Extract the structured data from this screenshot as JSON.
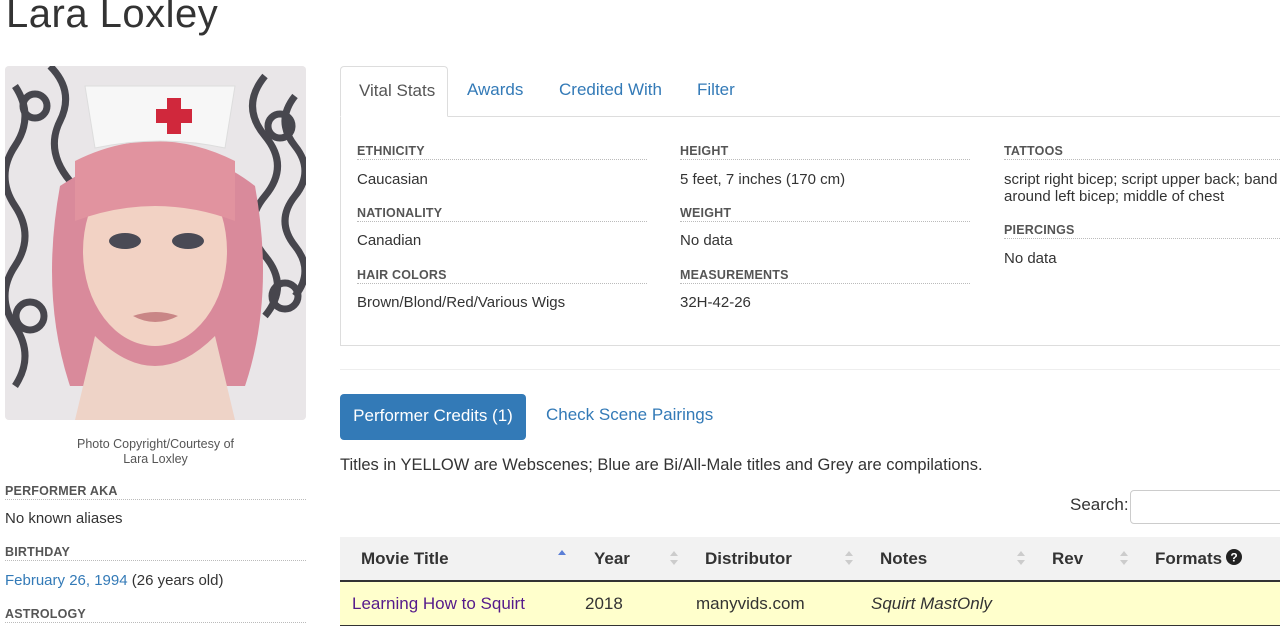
{
  "performer": {
    "name": "Lara Loxley",
    "photo_caption_line1": "Photo Copyright/Courtesy of",
    "photo_caption_line2": "Lara Loxley"
  },
  "bio": {
    "aka_label": "PERFORMER AKA",
    "aka_value": "No known aliases",
    "birthday_label": "BIRTHDAY",
    "birthday_date": "February 26, 1994",
    "birthday_age": " (26 years old)",
    "astrology_label": "ASTROLOGY"
  },
  "tabs": [
    {
      "label": "Vital Stats",
      "active": true
    },
    {
      "label": "Awards"
    },
    {
      "label": "Credited With"
    },
    {
      "label": "Filter"
    }
  ],
  "vital_stats": {
    "ethnicity_label": "ETHNICITY",
    "ethnicity_value": "Caucasian",
    "nationality_label": "NATIONALITY",
    "nationality_value": "Canadian",
    "hair_label": "HAIR COLORS",
    "hair_value": "Brown/Blond/Red/Various Wigs",
    "height_label": "HEIGHT",
    "height_value": "5 feet, 7 inches (170 cm)",
    "weight_label": "WEIGHT",
    "weight_value": "No data",
    "measurements_label": "MEASUREMENTS",
    "measurements_value": "32H-42-26",
    "tattoos_label": "TATTOOS",
    "tattoos_line1": "script right bicep; script upper back; band",
    "tattoos_line2": "around left bicep; middle of chest",
    "piercings_label": "PIERCINGS",
    "piercings_value": "No data"
  },
  "credits": {
    "primary_button": "Performer Credits (1)",
    "secondary_link": "Check Scene Pairings",
    "legend": "Titles in YELLOW are Webscenes; Blue are Bi/All-Male titles and Grey are compilations.",
    "search_label": "Search:",
    "search_value": ""
  },
  "table": {
    "columns": [
      "Movie Title",
      "Year",
      "Distributor",
      "Notes",
      "Rev",
      "Formats"
    ],
    "rows": [
      {
        "title": "Learning How to Squirt",
        "year": "2018",
        "distributor": "manyvids.com",
        "notes": "Squirt MastOnly",
        "rev": "",
        "formats": ""
      }
    ]
  },
  "colors": {
    "link": "#337ab7",
    "primary_button": "#337ab7",
    "webscene_row": "#ffffcc",
    "visited_link": "#551a8b"
  }
}
